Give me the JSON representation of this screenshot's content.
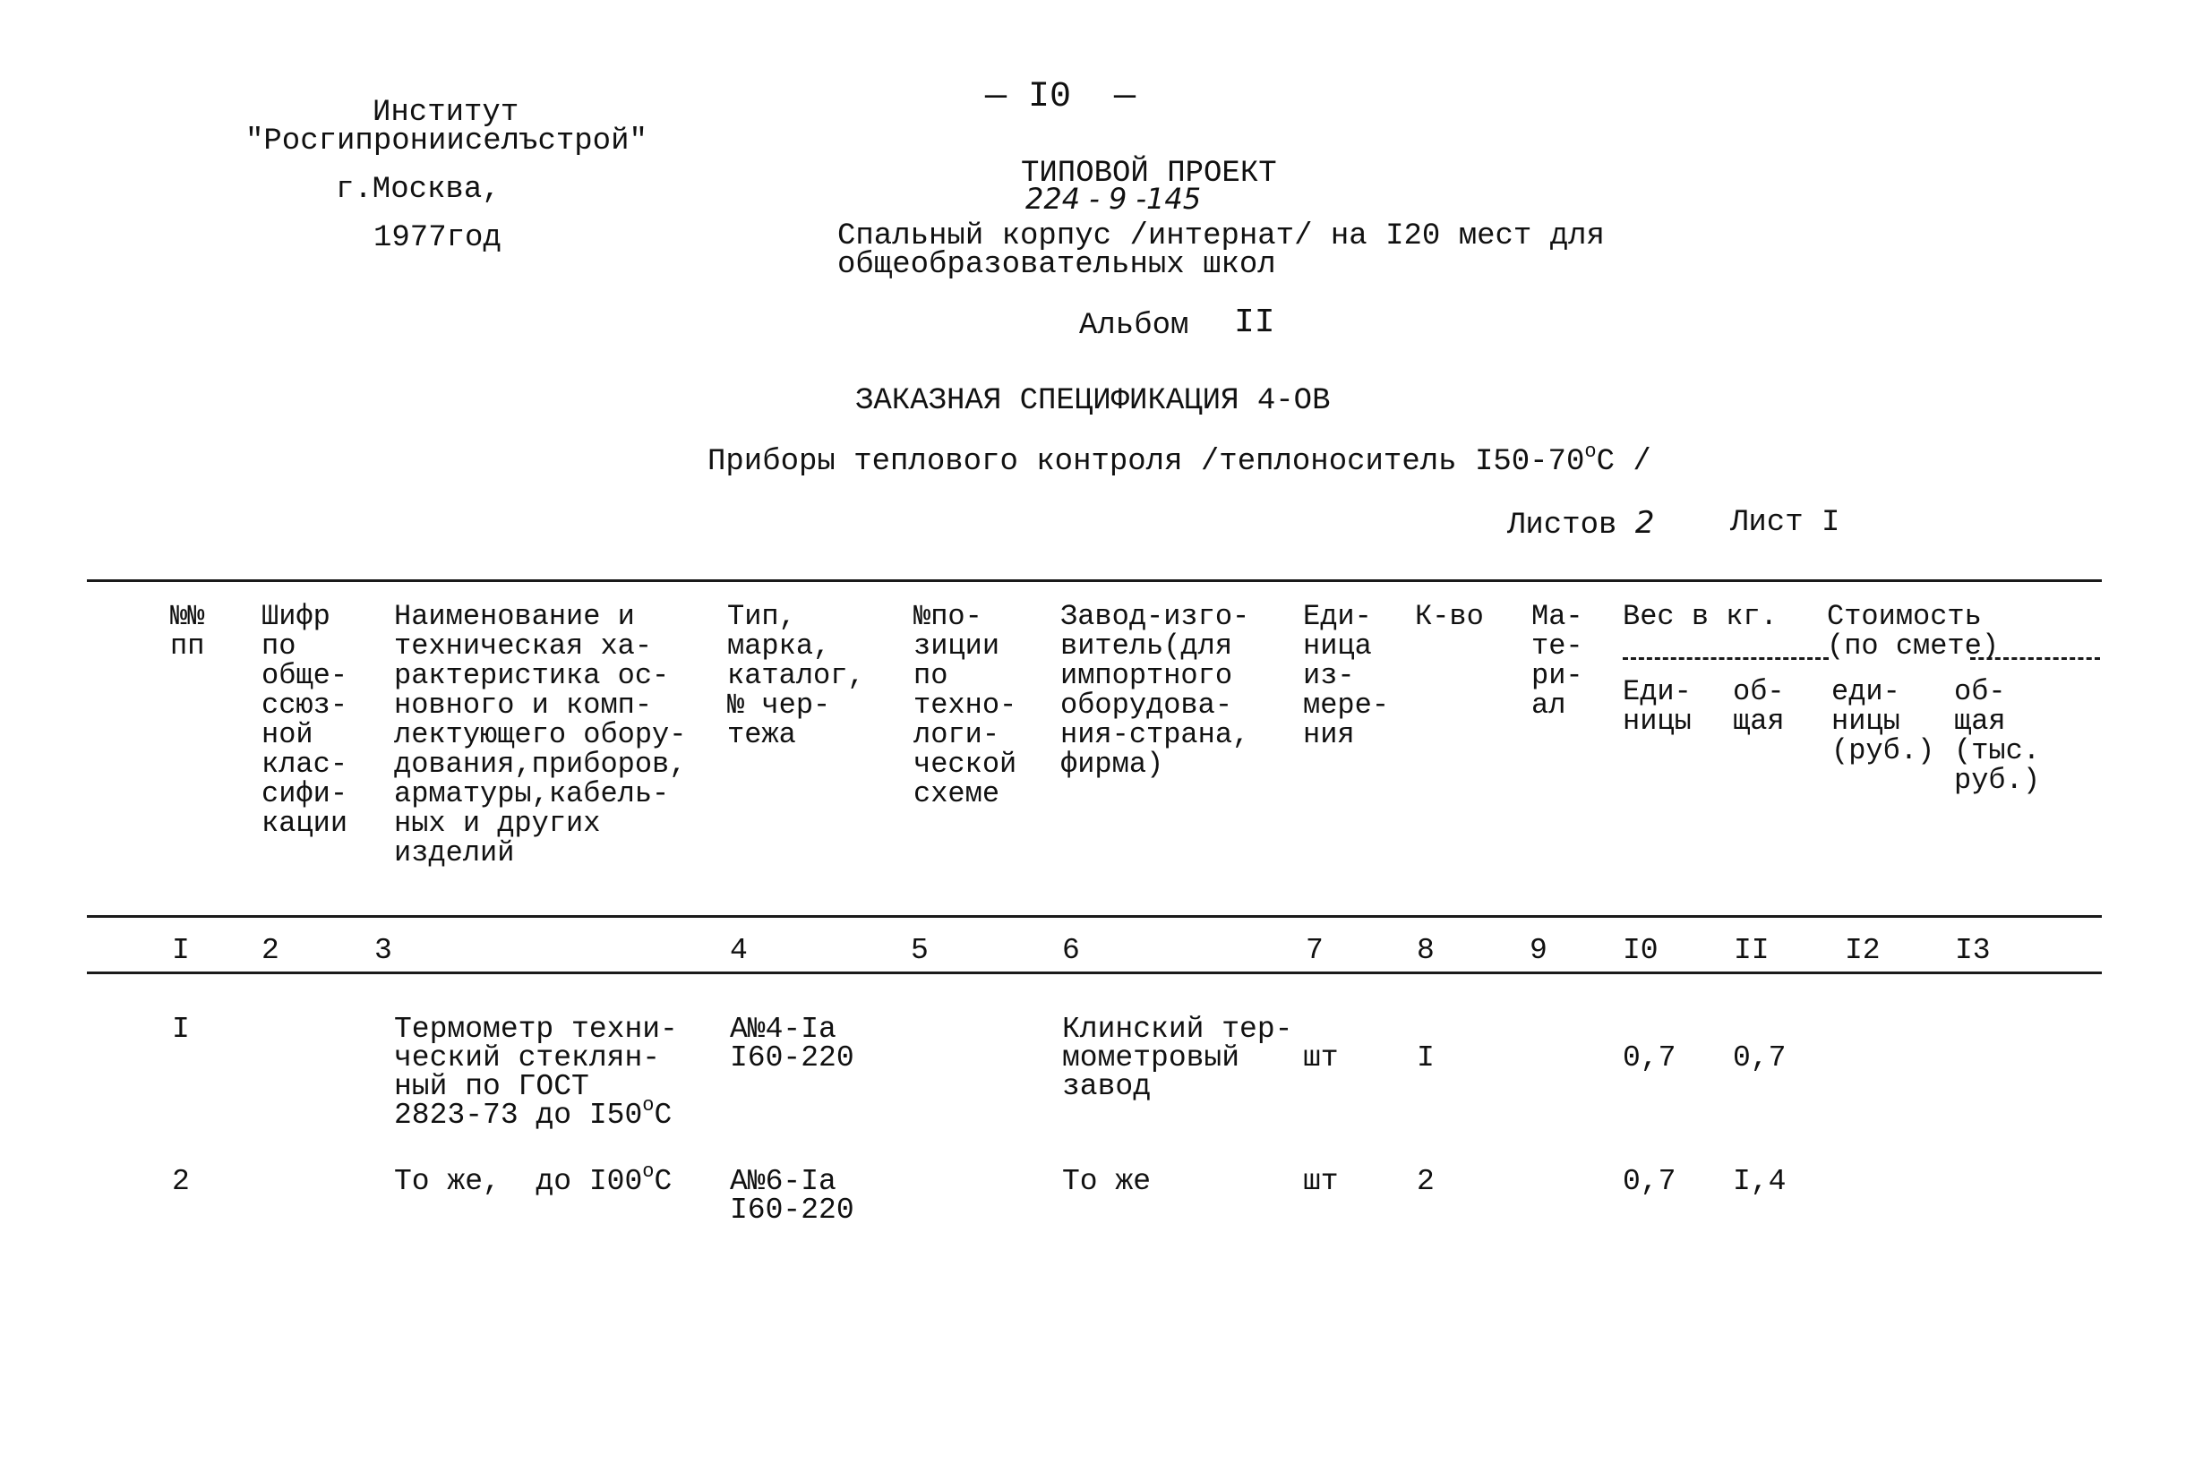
{
  "institute": {
    "line1": "Институт",
    "line2": "\"Росгипронииселъстрой\"",
    "city": "г.Москва,",
    "year": "1977год"
  },
  "page_number": "— I0  —",
  "project": {
    "title": "ТИПОВОЙ ПРОЕКТ",
    "code": "224 - 9 -145",
    "description_line1": "Спальный корпус /интернат/ на I20 мест для",
    "description_line2": "общеобразовательных школ",
    "album_label": "Альбом",
    "album_number": "II"
  },
  "spec": {
    "title": "ЗАКАЗНАЯ СПЕЦИФИКАЦИЯ 4-ОВ",
    "subtitle_main": "Приборы теплового контроля /теплоноситель I50-70",
    "subtitle_deg": "о",
    "subtitle_tail": "С /",
    "sheets_label": "Листов",
    "sheets_total": "2",
    "sheet_label": "Лист",
    "sheet_number": "I"
  },
  "table": {
    "headers": [
      "№№\nпп",
      "Шифр\nпо\nобще-\nссюз-\nной\nклас-\nсифи-\nкации",
      "Наименование и\nтехническая ха-\nрактеристика ос-\nновного и комп-\nлектующего обору-\nдования,приборов,\nарматуры,кабель-\nных и других\nизделий",
      "Тип,\nмарка,\nкаталог,\n№ чер-\nтежа",
      "№по-\nзиции\nпо\nтехно-\nлоги-\nческой\nсхеме",
      "Завод-изго-\nвитель(для\nимпортного\nоборудова-\nния-страна,\nфирма)",
      "Еди-\nница\nиз-\nмере-\nния",
      "К-во",
      "Ма-\nте-\nри-\nал",
      "Вес в кг.",
      "Стоимость\n(по смете)"
    ],
    "subheaders": {
      "weight_unit": "Еди-\nницы",
      "weight_total": "об-\nщая",
      "cost_unit": "еди-\nницы\n(руб.)",
      "cost_total": "об-\nщая\n(тыс.\nруб.)"
    },
    "column_numbers": [
      "I",
      "2",
      "3",
      "4",
      "5",
      "6",
      "7",
      "8",
      "9",
      "I0",
      "II",
      "I2",
      "I3"
    ],
    "rows": [
      {
        "num": "I",
        "code": "",
        "name_lines": [
          "Термометр техни-",
          "ческий стеклян-",
          "ный по ГОСТ",
          "2823-73 до I50"
        ],
        "name_deg": "о",
        "name_tail": "С",
        "type": "А№4-Iа\nI60-220",
        "position": "",
        "manufacturer": "Клинский тер-\nмометровый\nзавод",
        "unit": "шт",
        "qty": "I",
        "material": "",
        "weight_unit": "0,7",
        "weight_total": "0,7",
        "cost_unit": "",
        "cost_total": ""
      },
      {
        "num": "2",
        "code": "",
        "name_main": "То же,  до I00",
        "name_deg": "о",
        "name_tail": "С",
        "type": "А№6-Iа\nI60-220",
        "position": "",
        "manufacturer": "То же",
        "unit": "шт",
        "qty": "2",
        "material": "",
        "weight_unit": "0,7",
        "weight_total": "I,4",
        "cost_unit": "",
        "cost_total": ""
      }
    ]
  }
}
